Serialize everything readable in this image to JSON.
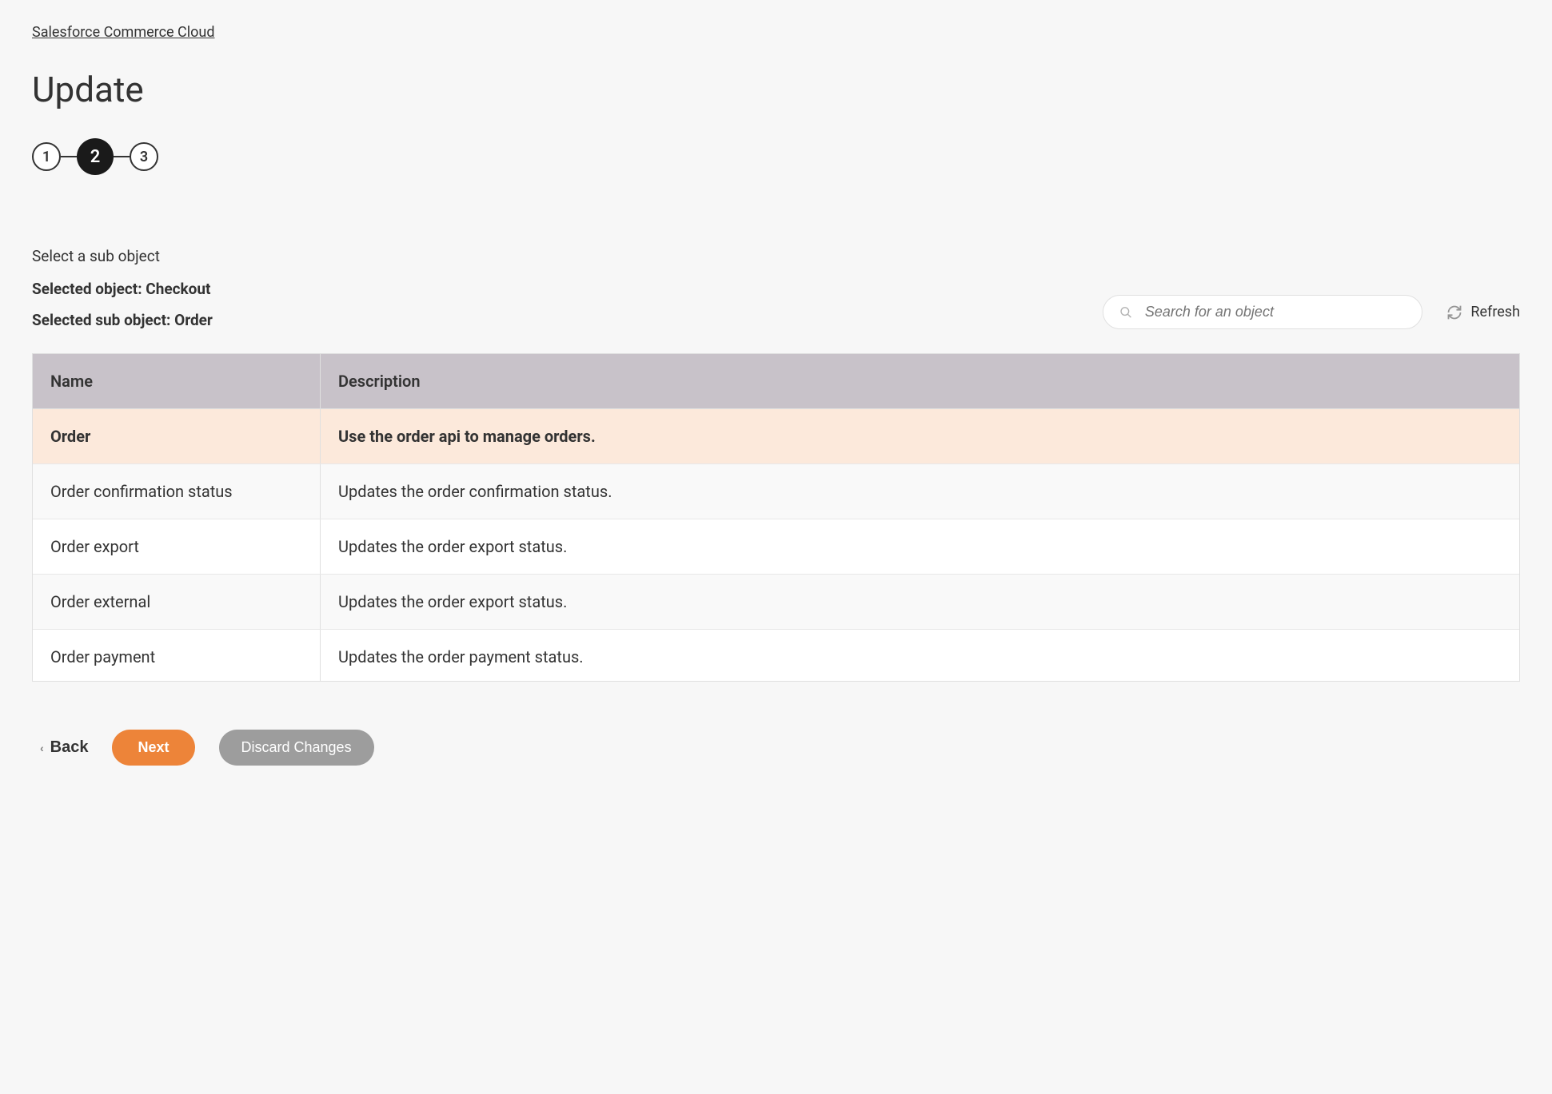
{
  "breadcrumb": "Salesforce Commerce Cloud",
  "page_title": "Update",
  "stepper": {
    "steps": [
      "1",
      "2",
      "3"
    ],
    "active_index": 1
  },
  "instruction": "Select a sub object",
  "selected_object_label": "Selected object: Checkout",
  "selected_sub_object_label": "Selected sub object: Order",
  "search": {
    "placeholder": "Search for an object"
  },
  "refresh_label": "Refresh",
  "table": {
    "headers": {
      "name": "Name",
      "description": "Description"
    },
    "rows": [
      {
        "name": "Order",
        "description": "Use the order api to manage orders.",
        "selected": true
      },
      {
        "name": "Order confirmation status",
        "description": "Updates the order confirmation status.",
        "selected": false
      },
      {
        "name": "Order export",
        "description": "Updates the order export status.",
        "selected": false
      },
      {
        "name": "Order external",
        "description": "Updates the order export status.",
        "selected": false
      },
      {
        "name": "Order payment",
        "description": "Updates the order payment status.",
        "selected": false
      }
    ]
  },
  "footer": {
    "back_label": "Back",
    "next_label": "Next",
    "discard_label": "Discard Changes"
  }
}
